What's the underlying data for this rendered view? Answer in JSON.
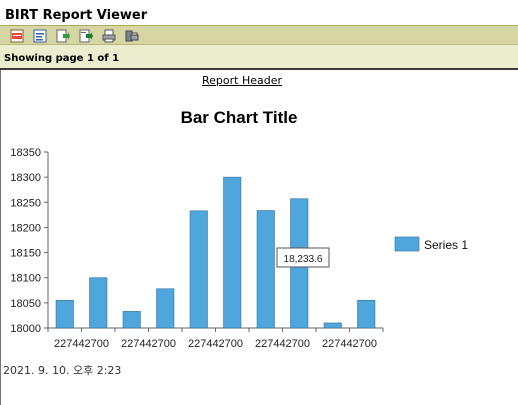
{
  "window": {
    "title": "BIRT Report Viewer"
  },
  "toolbar": {
    "buttons": [
      {
        "name": "toc-icon"
      },
      {
        "name": "parameters-icon"
      },
      {
        "name": "export-data-icon"
      },
      {
        "name": "export-report-icon"
      },
      {
        "name": "print-icon"
      },
      {
        "name": "print-server-icon"
      }
    ]
  },
  "status": {
    "page_text": "Showing page  1  of  1"
  },
  "report": {
    "header": "Report Header",
    "timestamp": "2021. 9. 10. 오후 2:23"
  },
  "chart_data": {
    "type": "bar",
    "title": "Bar Chart Title",
    "categories": [
      "227442700",
      "",
      "227442700",
      "",
      "227442700",
      "",
      "227442700",
      "",
      "227442700",
      "",
      ""
    ],
    "series": [
      {
        "name": "Series 1",
        "values": [
          18055,
          18100,
          18033,
          18078,
          18233,
          18300,
          18233.6,
          18257,
          18010,
          18055
        ],
        "color": "#4ea6dc"
      }
    ],
    "ylim": [
      18000,
      18350
    ],
    "yticks": [
      18000,
      18050,
      18100,
      18150,
      18200,
      18250,
      18300,
      18350
    ],
    "xlabels": [
      "227442700",
      "227442700",
      "227442700",
      "227442700",
      "227442700"
    ],
    "legend": "right",
    "tooltip": "18,233.6"
  }
}
